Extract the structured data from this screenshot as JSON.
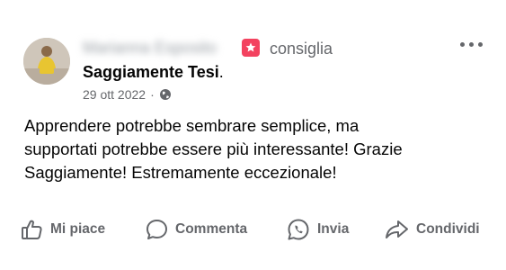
{
  "post": {
    "author_name_blurred": "Marianna Esposito",
    "recommendation_label": "consiglia",
    "page_name": "Saggiamente Tesi",
    "page_name_suffix": ".",
    "date": "29 ott 2022",
    "meta_separator": "·",
    "body_line_1": "Apprendere potrebbe sembrare semplice, ma",
    "body_line_2": "supportati potrebbe essere più interessante! Grazie",
    "body_line_3": "Saggiamente! Estremamente eccezionale!"
  },
  "actions": {
    "like_label": "Mi piace",
    "comment_label": "Commenta",
    "send_label": "Invia",
    "share_label": "Condividi"
  },
  "colors": {
    "recommend_accent": "#f3425f",
    "secondary_text": "#65676b",
    "primary_text": "#050505"
  },
  "icons": {
    "recommend": "star-badge-icon",
    "more": "ellipsis-icon",
    "audience": "globe-icon",
    "like": "thumbs-up-icon",
    "comment": "speech-bubble-icon",
    "send": "whatsapp-icon",
    "share": "share-arrow-icon"
  }
}
